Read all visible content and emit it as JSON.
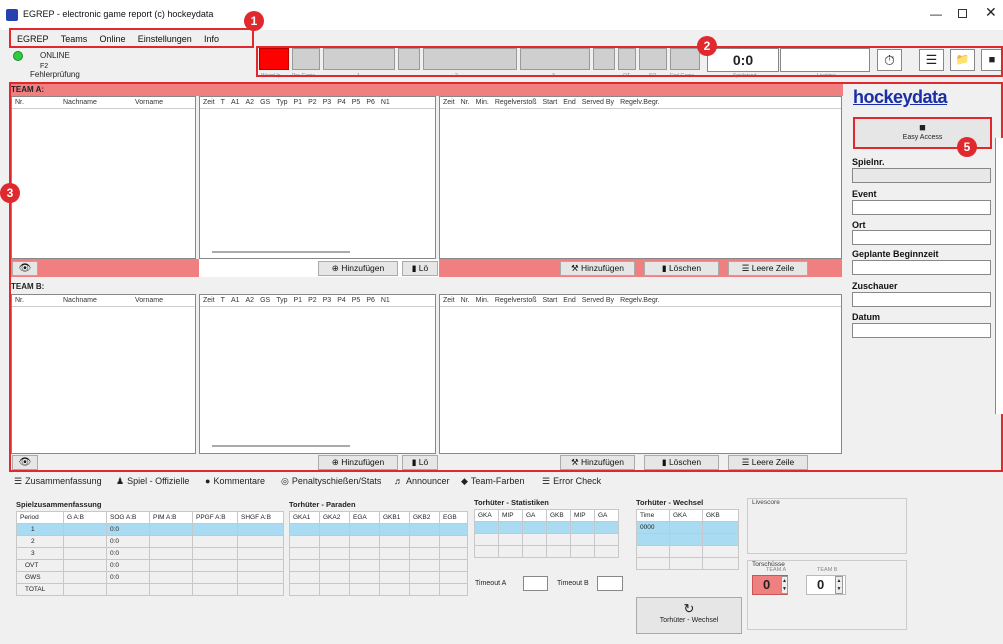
{
  "window": {
    "title": "EGREP - electronic game report (c) hockeydata",
    "app_icon": "egrep-app-icon"
  },
  "menu": [
    "EGREP",
    "Teams",
    "Online",
    "Einstellungen",
    "Info"
  ],
  "status": {
    "online": "ONLINE",
    "code": "F2",
    "check": "Fehlerprüfung",
    "color": "#2ecc40"
  },
  "periods": {
    "labels": [
      "WarmUp",
      "Pre-Game",
      "1",
      "2",
      "3",
      "OT",
      "SO",
      "End-Game",
      "Spielstand",
      "Livetime"
    ],
    "active_color": "#ff0000"
  },
  "score": "0:0",
  "toolbar_icons": [
    "stopwatch-icon",
    "list-icon",
    "folder-add-icon",
    "reader-icon"
  ],
  "badges": [
    "1",
    "2",
    "3",
    "5"
  ],
  "teamA": {
    "title": "TEAM A:",
    "roster_cols": [
      "Nr.",
      "Nachname",
      "Vorname"
    ],
    "events_cols": [
      "Zeit",
      "T",
      "A1",
      "A2",
      "GS",
      "Typ",
      "P1",
      "P2",
      "P3",
      "P4",
      "P5",
      "P6",
      "N1"
    ],
    "penalty_cols": [
      "Zeit",
      "Nr.",
      "Min.",
      "Regelverstoß",
      "Start",
      "End",
      "Served By",
      "Regelv.Begr."
    ],
    "add_label": "Hinzufügen",
    "delete_short": "Lö",
    "add_label2": "Hinzufügen",
    "delete_label": "Löschen",
    "empty_row": "Leere Zeile"
  },
  "teamB": {
    "title": "TEAM B:",
    "roster_cols": [
      "Nr.",
      "Nachname",
      "Vorname"
    ],
    "events_cols": [
      "Zeit",
      "T",
      "A1",
      "A2",
      "GS",
      "Typ",
      "P1",
      "P2",
      "P3",
      "P4",
      "P5",
      "P6",
      "N1"
    ],
    "penalty_cols": [
      "Zeit",
      "Nr.",
      "Min.",
      "Regelverstoß",
      "Start",
      "End",
      "Served By",
      "Regelv.Begr."
    ],
    "add_label": "Hinzufügen",
    "delete_short": "Lö",
    "add_label2": "Hinzufügen",
    "delete_label": "Löschen",
    "empty_row": "Leere Zeile"
  },
  "right": {
    "logo": "hockeydata",
    "easy_access": "Easy Access",
    "fields": [
      "Spielnr.",
      "Event",
      "Ort",
      "Geplante Beginnzeit",
      "Zuschauer",
      "Datum"
    ],
    "accent": "#1a2ea8"
  },
  "tabs": [
    "Zusammenfassung",
    "Spiel - Offizielle",
    "Kommentare",
    "Penaltyschießen/Stats",
    "Announcer",
    "Team-Farben",
    "Error Check"
  ],
  "summary": {
    "title": "Spielzusammenfassung",
    "cols": [
      "Period",
      "G A:B",
      "SOG A:B",
      "PIM A:B",
      "PPGF A:B",
      "SHGF A:B"
    ],
    "rows": [
      [
        "1",
        "",
        "0:0",
        "",
        "",
        ""
      ],
      [
        "2",
        "",
        "0:0",
        "",
        "",
        ""
      ],
      [
        "3",
        "",
        "0:0",
        "",
        "",
        ""
      ],
      [
        "OVT",
        "",
        "0:0",
        "",
        "",
        ""
      ],
      [
        "GWS",
        "",
        "0:0",
        "",
        "",
        ""
      ],
      [
        "TOTAL",
        "",
        "",
        "",
        "",
        ""
      ]
    ]
  },
  "saves": {
    "title": "Torhüter - Paraden",
    "cols": [
      "GKA1",
      "GKA2",
      "EGA",
      "GKB1",
      "GKB2",
      "EGB"
    ]
  },
  "gstats": {
    "title": "Torhüter - Statistiken",
    "cols": [
      "GKA",
      "MIP",
      "GA",
      "GKB",
      "MIP",
      "GA"
    ],
    "timeout_a": "Timeout A",
    "timeout_b": "Timeout B"
  },
  "gchange": {
    "title": "Torhüter - Wechsel",
    "cols": [
      "Time",
      "GKA",
      "GKB"
    ],
    "first_time": "0000",
    "button": "Torhüter - Wechsel"
  },
  "livescore": {
    "title": "Livescore"
  },
  "shots": {
    "title": "Torschüsse",
    "team_a": "TEAM A",
    "team_b": "TEAM B",
    "a": "0",
    "b": "0"
  }
}
